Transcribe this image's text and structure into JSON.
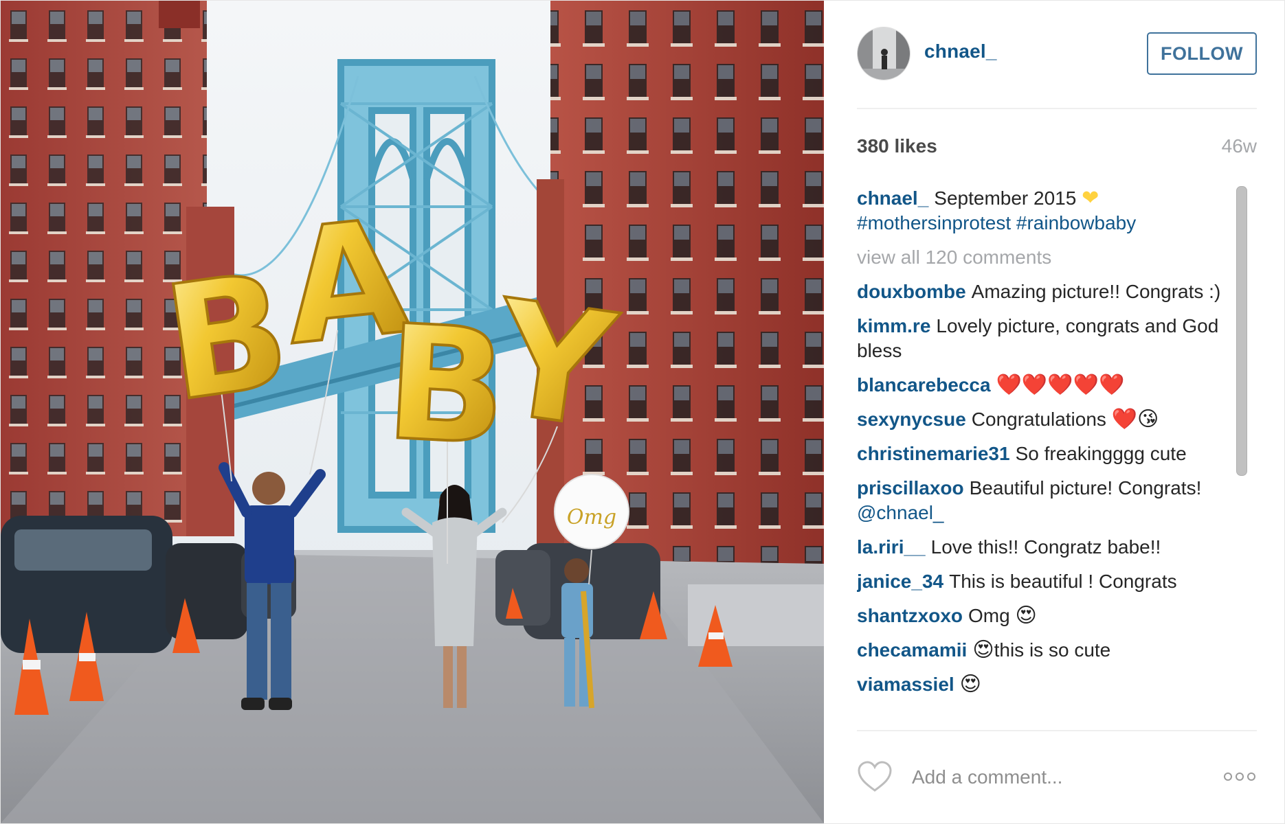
{
  "post": {
    "username": "chnael_",
    "follow_label": "FOLLOW",
    "likes": "380 likes",
    "time_ago": "46w",
    "photo": {
      "icon": "photo",
      "balloon_letters": [
        "B",
        "A",
        "B",
        "Y"
      ],
      "balloon_text": "Omg"
    }
  },
  "caption": {
    "username": "chnael_",
    "text": "September 2015",
    "emoji": "yellow-heart",
    "hashtags": "#mothersinprotest #rainbowbaby"
  },
  "view_all_label": "view all 120 comments",
  "comments": [
    {
      "username": "douxbombe",
      "text": "Amazing picture!! Congrats :)"
    },
    {
      "username": "kimm.re",
      "text": "Lovely picture, congrats and God bless"
    },
    {
      "username": "blancarebecca",
      "text": "",
      "emoji": "❤️❤️❤️❤️❤️"
    },
    {
      "username": "sexynycsue",
      "text": "Congratulations",
      "emoji": "❤️😘"
    },
    {
      "username": "christinemarie31",
      "text": "So freakingggg cute"
    },
    {
      "username": "priscillaxoo",
      "text": "Beautiful picture! Congrats!",
      "mention": "@chnael_"
    },
    {
      "username": "la.riri__",
      "text": "Love this!! Congratz babe!!"
    },
    {
      "username": "janice_34",
      "text": "This is beautiful ! Congrats"
    },
    {
      "username": "shantzxoxo",
      "text": "Omg",
      "emoji": "😍"
    },
    {
      "username": "checamamii",
      "text": "this is so cute",
      "emoji_before": "😍"
    },
    {
      "username": "viamassiel",
      "text": "",
      "emoji": "😍"
    }
  ],
  "comment_input": {
    "placeholder": "Add a comment..."
  },
  "icons": {
    "like": "heart-outline-icon",
    "more": "more-options-icon"
  },
  "colors": {
    "link": "#125688",
    "follow": "#3f729b",
    "muted": "#a5a7aa",
    "text": "#262626"
  }
}
